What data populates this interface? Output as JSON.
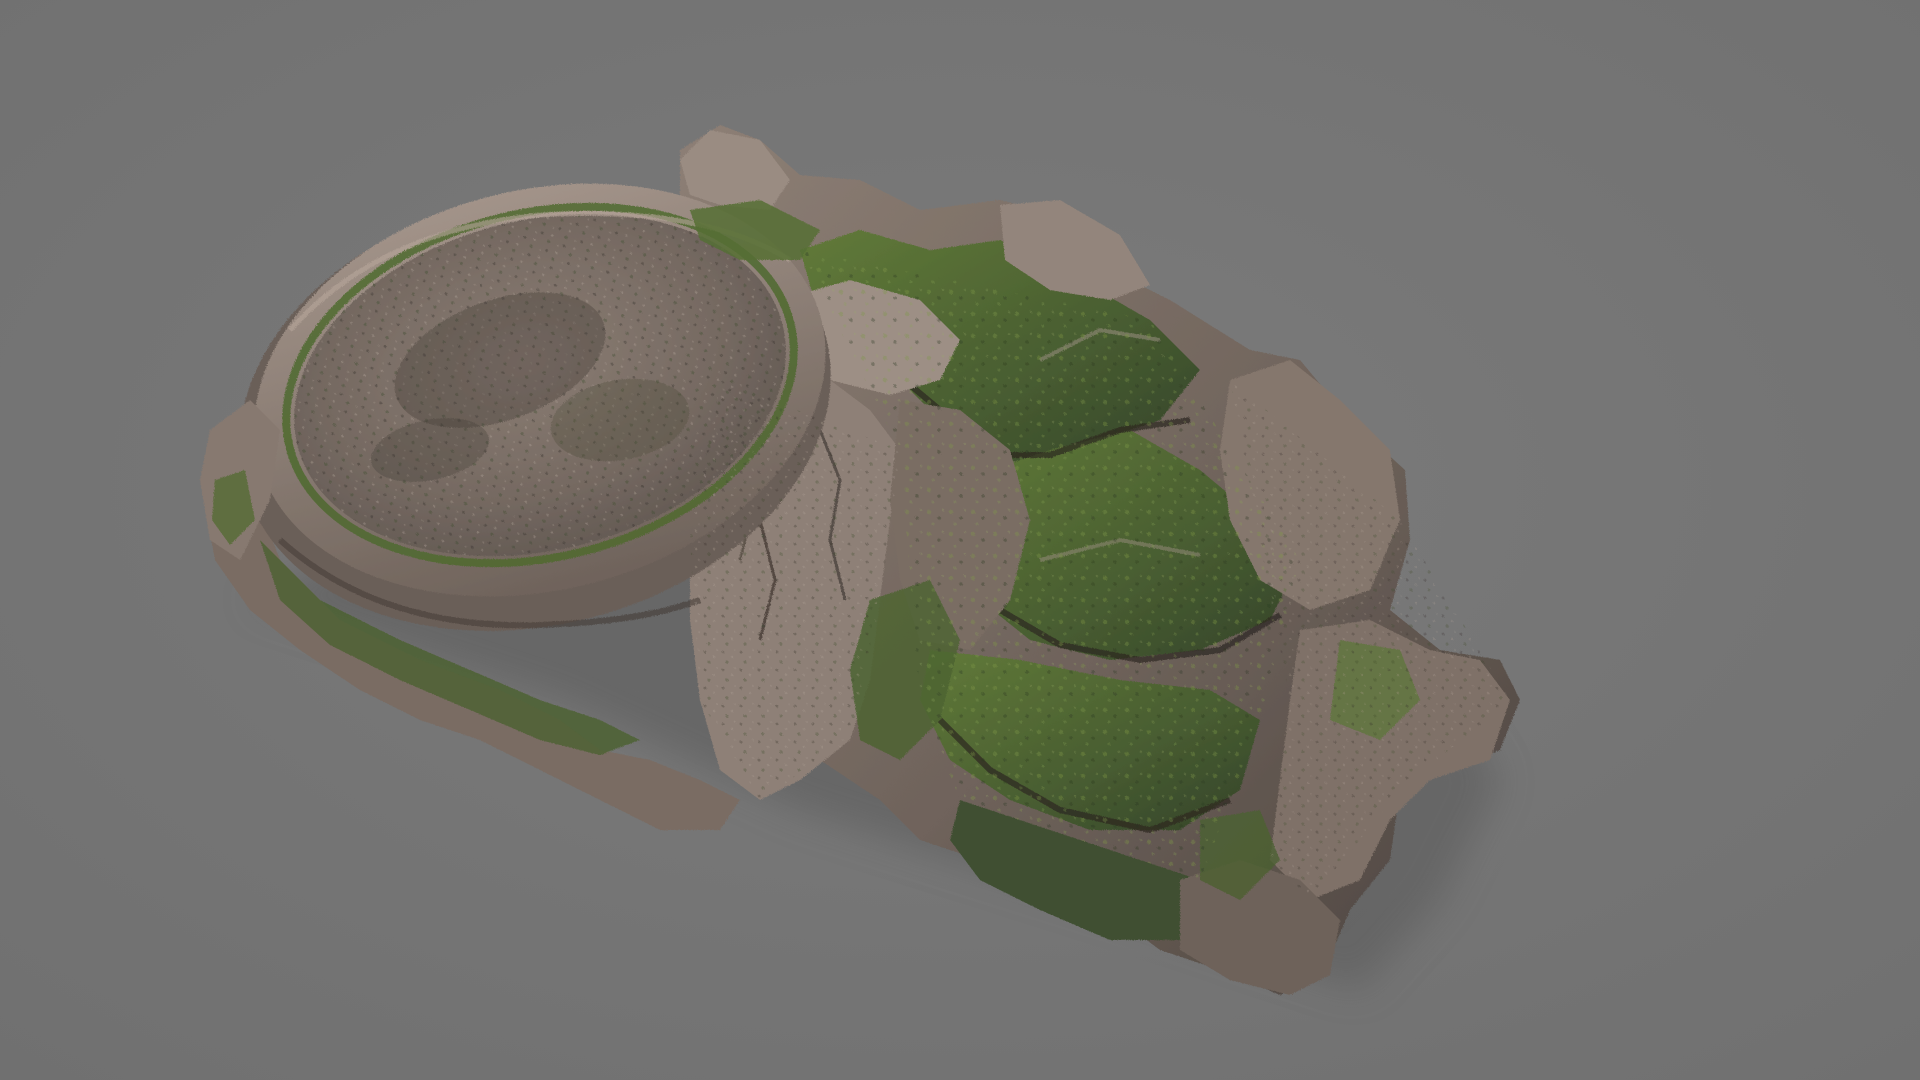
{
  "scene": {
    "subject": "rock-platform-model",
    "background_color": "#757575",
    "palette": {
      "stone_light": "#9a8a7f",
      "stone_mid": "#7d6f66",
      "stone_dark": "#4d453f",
      "moss_light": "#6f8a3c",
      "moss_mid": "#4f6534",
      "moss_dark": "#33422a",
      "shadow": "#626262"
    }
  }
}
